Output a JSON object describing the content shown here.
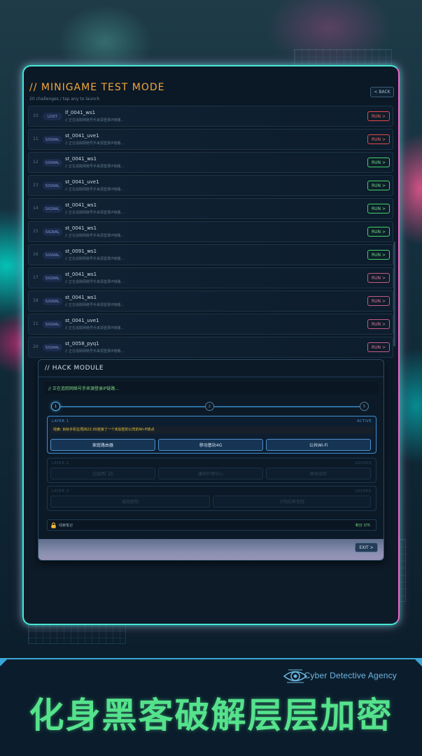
{
  "header": {
    "title": "// MINIGAME TEST MODE",
    "subtitle": "20 challenges / tap any to launch",
    "back_label": "< BACK"
  },
  "challenges": [
    {
      "num": "10",
      "badge": "LOST",
      "name": "lf_0041_ws1",
      "desc": "// 正在追踪网络号手来源登录IP链路...",
      "run": "RUN >",
      "run_color": "red"
    },
    {
      "num": "11",
      "badge": "SIGNAL",
      "name": "st_0041_uve1",
      "desc": "// 正在追踪网络号手来源登录IP链路...",
      "run": "RUN >",
      "run_color": "red"
    },
    {
      "num": "12",
      "badge": "SIGNAL",
      "name": "st_0041_ws1",
      "desc": "// 正在追踪网络号手来源登录IP链路...",
      "run": "RUN >",
      "run_color": "green"
    },
    {
      "num": "13",
      "badge": "SIGNAL",
      "name": "st_0041_uve1",
      "desc": "// 正在追踪网络号手来源登录IP链路...",
      "run": "RUN >",
      "run_color": "green"
    },
    {
      "num": "14",
      "badge": "SIGNAL",
      "name": "st_0041_ws1",
      "desc": "// 正在追踪网络号手来源登录IP链路...",
      "run": "RUN >",
      "run_color": "green"
    },
    {
      "num": "15",
      "badge": "SIGNAL",
      "name": "st_0041_ws1",
      "desc": "// 正在追踪网络号手来源登录IP链路...",
      "run": "RUN >",
      "run_color": "green"
    },
    {
      "num": "16",
      "badge": "SIGNAL",
      "name": "st_0091_ws1",
      "desc": "// 正在追踪网络号手来源登录IP链路...",
      "run": "RUN >",
      "run_color": "green"
    },
    {
      "num": "17",
      "badge": "SIGNAL",
      "name": "st_0041_ws1",
      "desc": "// 正在追踪网络号手来源登录IP链路...",
      "run": "RUN >",
      "run_color": "pink"
    },
    {
      "num": "18",
      "badge": "SIGNAL",
      "name": "st_0041_ws1",
      "desc": "// 正在追踪网络号手来源登录IP链路...",
      "run": "RUN >",
      "run_color": "pink"
    },
    {
      "num": "11",
      "badge": "SIGNAL",
      "name": "st_0041_uve1",
      "desc": "// 正在追踪网络号手来源登录IP链路...",
      "run": "RUN >",
      "run_color": "pink"
    },
    {
      "num": "20",
      "badge": "SIGNAL",
      "name": "st_0058_pyq1",
      "desc": "// 正在追踪网络号手来源登录IP链路...",
      "run": "RUN >",
      "run_color": "pink"
    }
  ],
  "hack": {
    "title": "// HACK MODULE",
    "status": "// 正在追踪网络号手来源登录IP链路...",
    "steps": [
      "1",
      "2",
      "5"
    ],
    "layer1": {
      "label": "LAYER 1",
      "state": "ACTIVE",
      "clue": "线索: 目标手机在周四22:30连接了一个未加密的公司的Wi-Fi热点",
      "options": [
        "家庭路由器",
        "移动基站4G",
        "公共Wi-Fi"
      ]
    },
    "layer2": {
      "label": "LAYER 2",
      "state": "LOCKED",
      "options": [
        "庄园西门店",
        "康桥护理中心",
        "鲸舍会所"
      ]
    },
    "layer3": {
      "label": "LAYER 3",
      "state": "LOCKED",
      "options": [
        "城南医院",
        "夕阳红养老院"
      ]
    },
    "memo": "线索笔记",
    "score": "积分 375",
    "exit_label": "EXIT >"
  },
  "banner": {
    "agency": "Cyber Detective Agency",
    "slogan": "化身黑客破解层层加密"
  },
  "colors": {
    "accent_orange": "#f2a63c",
    "frame_cyan": "#46e6d4",
    "frame_pink": "#e56cc6",
    "run_red": "#e4484a",
    "run_green": "#3fd46a",
    "run_pink": "#c55a87",
    "slogan_green": "#55e28c"
  }
}
